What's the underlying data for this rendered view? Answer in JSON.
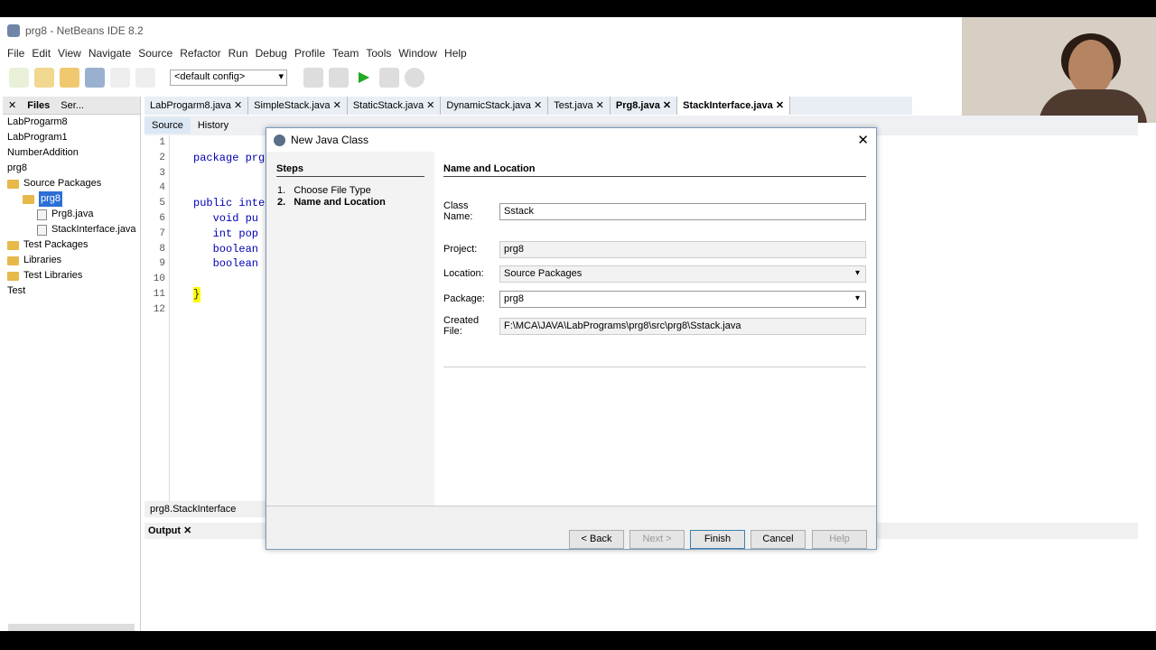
{
  "window": {
    "title": "prg8 - NetBeans IDE 8.2"
  },
  "menu": [
    "File",
    "Edit",
    "View",
    "Navigate",
    "Source",
    "Refactor",
    "Run",
    "Debug",
    "Profile",
    "Team",
    "Tools",
    "Window",
    "Help"
  ],
  "toolbar": {
    "config": "<default config>"
  },
  "left_panel": {
    "tabs": [
      "Files",
      "Ser..."
    ],
    "tree": [
      {
        "label": "LabProgarm8",
        "type": "project"
      },
      {
        "label": "LabProgram1",
        "type": "project"
      },
      {
        "label": "NumberAddition",
        "type": "project"
      },
      {
        "label": "prg8",
        "type": "project"
      },
      {
        "label": "Source Packages",
        "type": "folder"
      },
      {
        "label": "prg8",
        "type": "package",
        "selected": true
      },
      {
        "label": "Prg8.java",
        "type": "file"
      },
      {
        "label": "StackInterface.java",
        "type": "file"
      },
      {
        "label": "Test Packages",
        "type": "folder"
      },
      {
        "label": "Libraries",
        "type": "folder"
      },
      {
        "label": "Test Libraries",
        "type": "folder"
      },
      {
        "label": "Test",
        "type": "project"
      }
    ]
  },
  "editor_tabs": [
    {
      "label": "LabProgarm8.java"
    },
    {
      "label": "SimpleStack.java"
    },
    {
      "label": "StaticStack.java"
    },
    {
      "label": "DynamicStack.java"
    },
    {
      "label": "Test.java"
    },
    {
      "label": "Prg8.java"
    },
    {
      "label": "StackInterface.java",
      "active": true
    }
  ],
  "editor_toolbar": {
    "source": "Source",
    "history": "History"
  },
  "code": {
    "line_numbers": [
      "1",
      "2",
      "3",
      "4",
      "5",
      "6",
      "7",
      "8",
      "9",
      "10",
      "11",
      "12"
    ],
    "lines": [
      "",
      "package prg",
      "",
      "",
      "public inte",
      "   void pu",
      "   int pop",
      "   boolean",
      "   boolean",
      "",
      "}",
      ""
    ]
  },
  "status_breadcrumb": "prg8.StackInterface",
  "output_tab": "Output",
  "dialog": {
    "title": "New Java Class",
    "steps_header": "Steps",
    "steps": [
      {
        "num": "1.",
        "label": "Choose File Type"
      },
      {
        "num": "2.",
        "label": "Name and Location",
        "current": true
      }
    ],
    "section_header": "Name and Location",
    "fields": {
      "class_name": {
        "label": "Class Name:",
        "value": "Sstack"
      },
      "project": {
        "label": "Project:",
        "value": "prg8"
      },
      "location": {
        "label": "Location:",
        "value": "Source Packages"
      },
      "package": {
        "label": "Package:",
        "value": "prg8"
      },
      "created_file": {
        "label": "Created File:",
        "value": "F:\\MCA\\JAVA\\LabPrograms\\prg8\\src\\prg8\\Sstack.java"
      }
    },
    "buttons": {
      "back": "< Back",
      "next": "Next >",
      "finish": "Finish",
      "cancel": "Cancel",
      "help": "Help"
    }
  }
}
